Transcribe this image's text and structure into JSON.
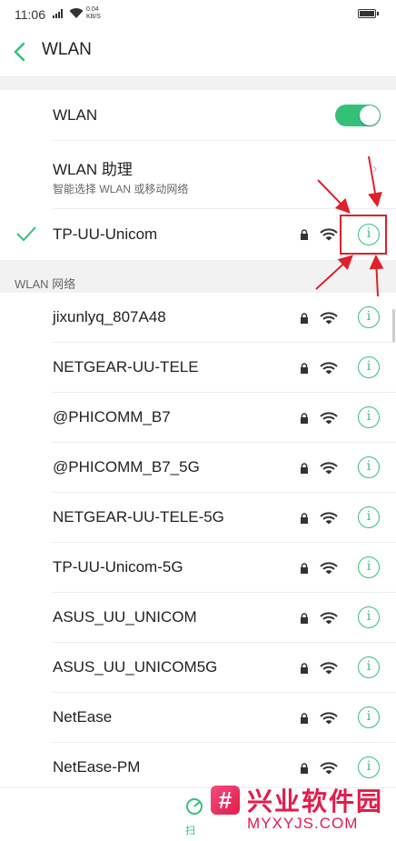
{
  "status_bar": {
    "time": "11:06",
    "speed_value": "0.04",
    "speed_unit": "KB/S"
  },
  "header": {
    "title": "WLAN"
  },
  "wlan_toggle": {
    "label": "WLAN",
    "on": true
  },
  "assistant": {
    "label": "WLAN 助理",
    "sub": "智能选择 WLAN 或移动网络"
  },
  "connected": {
    "ssid": "TP-UU-Unicom"
  },
  "section_title": "WLAN 网络",
  "networks": [
    {
      "ssid": "jixunlyq_807A48"
    },
    {
      "ssid": "NETGEAR-UU-TELE"
    },
    {
      "ssid": "@PHICOMM_B7"
    },
    {
      "ssid": "@PHICOMM_B7_5G"
    },
    {
      "ssid": "NETGEAR-UU-TELE-5G"
    },
    {
      "ssid": "TP-UU-Unicom-5G"
    },
    {
      "ssid": "ASUS_UU_UNICOM"
    },
    {
      "ssid": "ASUS_UU_UNICOM5G"
    },
    {
      "ssid": "NetEase"
    },
    {
      "ssid": "NetEase-PM"
    }
  ],
  "info_glyph": "i",
  "bottom": {
    "scan_label": "扫"
  },
  "watermark": {
    "logo_glyph": "#",
    "name": "兴业软件园",
    "domain": "MYXYJS.COM"
  },
  "colors": {
    "accent": "#33c17a",
    "annotation": "#e0202a"
  }
}
